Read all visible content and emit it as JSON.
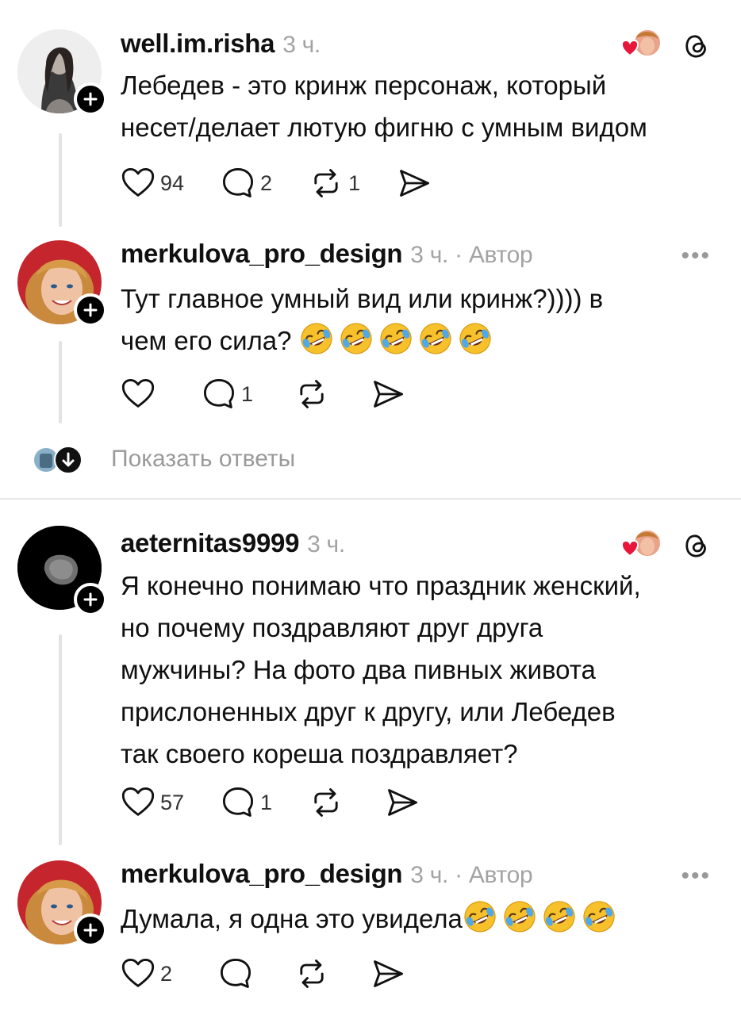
{
  "posts": [
    {
      "username": "well.im.risha",
      "time": "3 ч.",
      "lines": [
        "Лебедев - это кринж персонаж, который",
        "несет/делает лютую фигню с умным видом"
      ],
      "likes": "94",
      "replies": "2",
      "reposts": "1"
    },
    {
      "username": "merkulova_pro_design",
      "time": "3 ч. · Автор",
      "lines": [
        "Тут главное умный вид или кринж?)))) в",
        "чем его сила? "
      ],
      "likes": "",
      "replies": "1",
      "reposts": ""
    },
    {
      "username": "aeternitas9999",
      "time": "3 ч.",
      "lines": [
        "Я конечно понимаю что праздник женский,",
        "но почему поздравляют друг друга",
        "мужчины? На фото два пивных живота",
        "прислоненных друг к другу, или Лебедев",
        "так своего кореша поздравляет?"
      ],
      "likes": "57",
      "replies": "1",
      "reposts": ""
    },
    {
      "username": "merkulova_pro_design",
      "time": "3 ч. · Автор",
      "lines": [
        "Думала, я одна это увидела"
      ],
      "likes": "2",
      "replies": "",
      "reposts": ""
    }
  ],
  "show_replies": "Показать ответы",
  "more_label": "•••",
  "colors": {
    "heart": "#e8163a",
    "text": "#101010",
    "muted": "#a3a3a3"
  }
}
